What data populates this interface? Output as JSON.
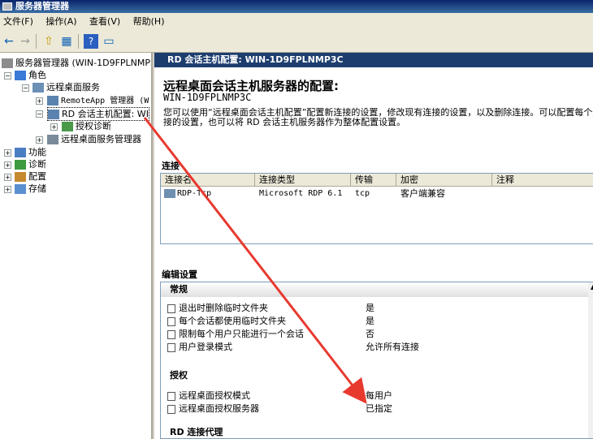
{
  "window": {
    "title": "服务器管理器"
  },
  "menu": [
    "文件(F)",
    "操作(A)",
    "查看(V)",
    "帮助(H)"
  ],
  "toolbar": {
    "back": "←",
    "forward": "→",
    "up": "⇧",
    "show": "▦",
    "help": "?",
    "pane": "▭"
  },
  "tree": {
    "root": "服务器管理器 (WIN-1D9FPLNMP3",
    "roles": "角色",
    "rds": "远程桌面服务",
    "remoteapp": "RemoteApp 管理器 (W",
    "rdsh_config": "RD 会话主机配置: WI",
    "licensing_diag": "授权诊断",
    "rds_manager": "远程桌面服务管理器",
    "features": "功能",
    "diagnostics": "诊断",
    "configuration": "配置",
    "storage": "存储"
  },
  "right": {
    "header": "RD 会话主机配置: WIN-1D9FPLNMP3C",
    "title": "远程桌面会话主机服务器的配置:",
    "server": "WIN-1D9FPLNMP3C",
    "desc1": "您可以使用“远程桌面会话主机配置”配置新连接的设置，修改现有连接的设置，以及删除连接。可以配置每个连",
    "desc2": "接的设置，也可以将 RD 会话主机服务器作为整体配置设置。",
    "connections_label": "连接",
    "columns": [
      "连接名",
      "连接类型",
      "传输",
      "加密",
      "注释"
    ],
    "row": {
      "name": "RDP-Tcp",
      "type": "Microsoft RDP 6.1",
      "transport": "tcp",
      "encryption": "客户端兼容",
      "comment": ""
    },
    "edit_label": "编辑设置",
    "groups": {
      "general": "常规",
      "licensing": "授权",
      "broker": "RD 连接代理"
    },
    "general_props": [
      {
        "name": "退出时删除临时文件夹",
        "value": "是"
      },
      {
        "name": "每个会话都使用临时文件夹",
        "value": "是"
      },
      {
        "name": "限制每个用户只能进行一个会话",
        "value": "否"
      },
      {
        "name": "用户登录模式",
        "value": "允许所有连接"
      }
    ],
    "licensing_props": [
      {
        "name": "远程桌面授权模式",
        "value": "每用户"
      },
      {
        "name": "远程桌面授权服务器",
        "value": "已指定"
      }
    ]
  },
  "colors": {
    "header_bg": "#1d3d6e",
    "arrow": "#e8392f"
  }
}
